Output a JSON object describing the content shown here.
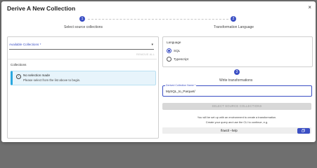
{
  "dialog": {
    "title": "Derive A New Collection",
    "close_glyph": "×"
  },
  "stepper": {
    "steps": [
      {
        "number": "1",
        "label": "Select source collections"
      },
      {
        "number": "2",
        "label": "Transformation Language"
      },
      {
        "number": "3",
        "label": "Write transformations"
      }
    ]
  },
  "left_panel": {
    "select": {
      "label": "Available Collections *",
      "arrow": "▾"
    },
    "remove_all_label": "REMOVE ALL",
    "collections_label": "Collections",
    "info": {
      "icon": "i",
      "title": "No selection made",
      "text": "Please select from the list above to begin."
    }
  },
  "right_panel": {
    "language_label": "Language",
    "languages": [
      {
        "label": "SQL",
        "checked": true
      },
      {
        "label": "Typescript",
        "checked": false
      }
    ],
    "derived_field": {
      "label": "Derived Collection Name *",
      "value": "MySQL_to_Parquet/"
    },
    "select_source_button": "SELECT SOURCE COLLECTIONS",
    "note_line1": "You will be set up with an environment to create a transformation.",
    "note_line2": "Create your query and use the CLI to continue, e.g.",
    "command": "flowctl --help"
  },
  "colors": {
    "accent": "#3b4fc4",
    "info_bar": "#29a8e0",
    "info_bg": "#e7f4fb",
    "disabled_button": "#d8d8d8"
  }
}
